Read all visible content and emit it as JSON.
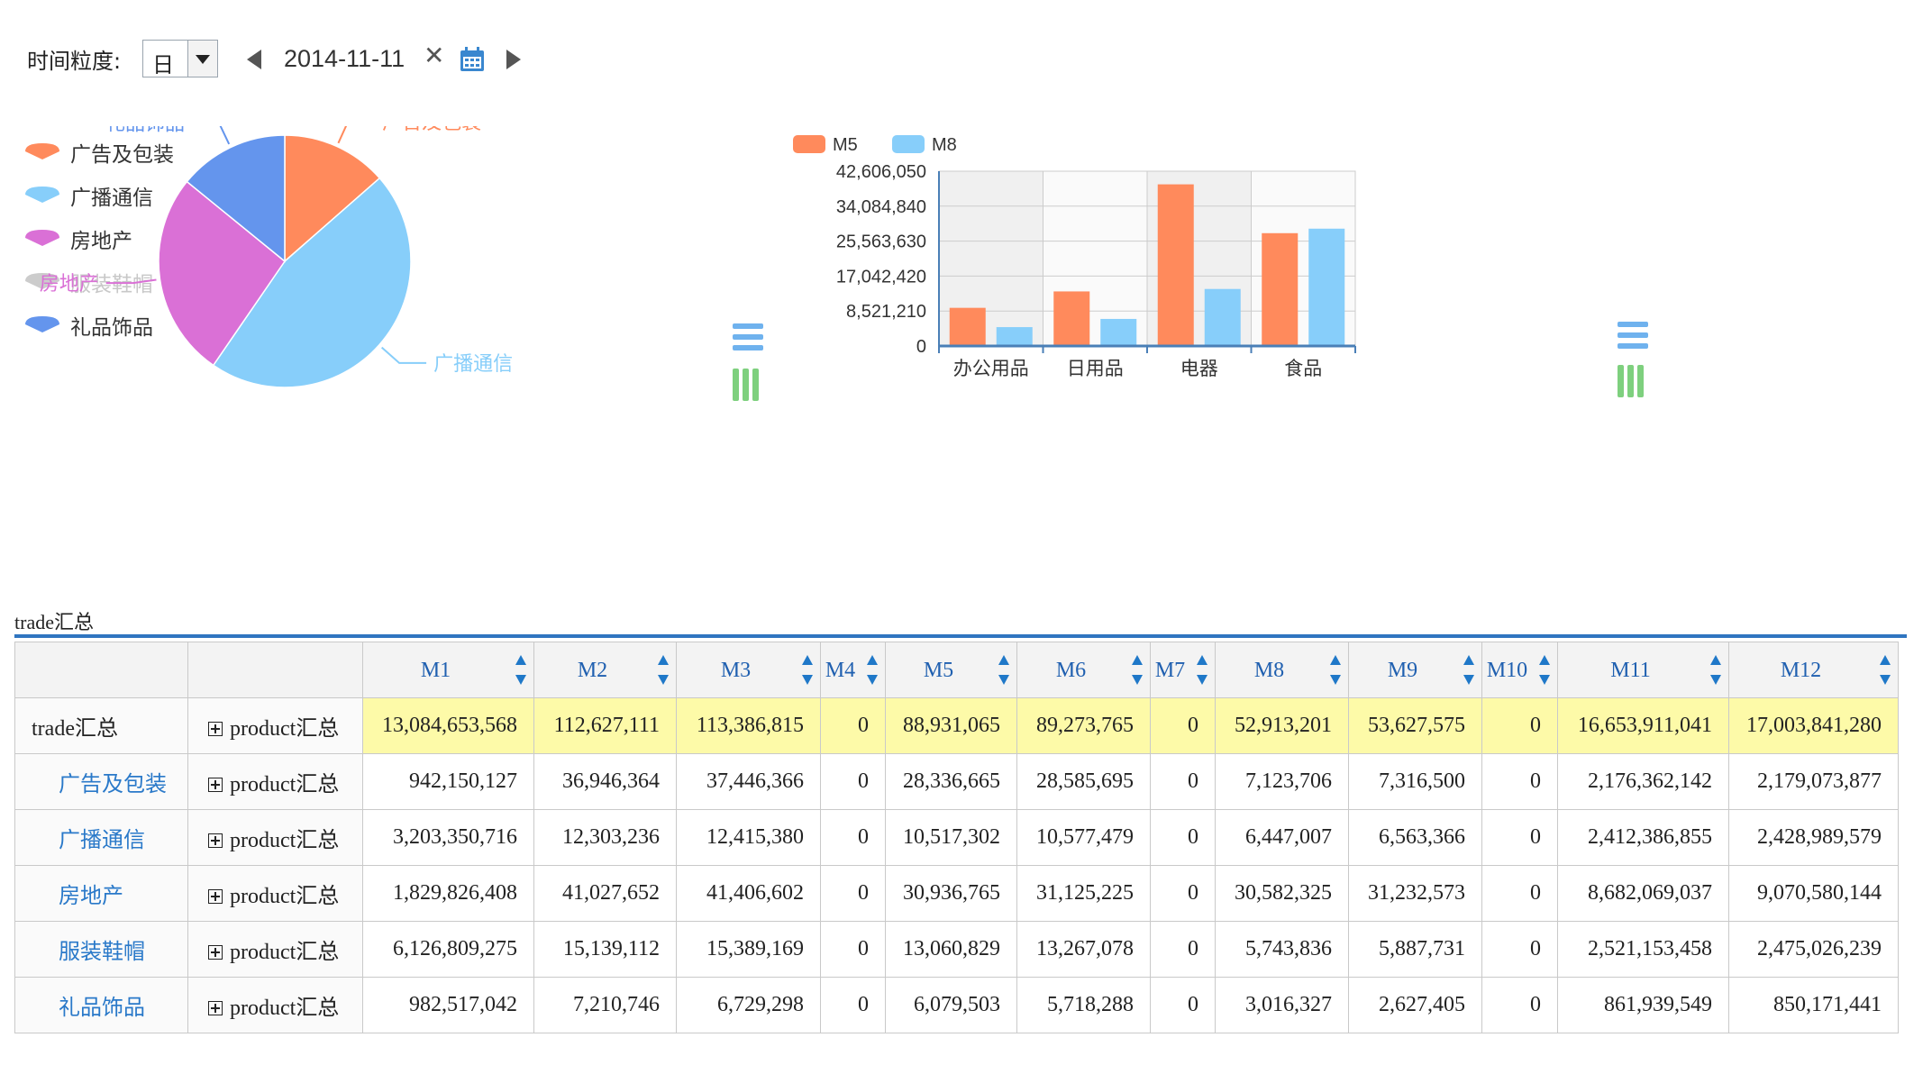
{
  "toolbar": {
    "granularity_label": "时间粒度:",
    "granularity_value": "日",
    "date": "2014-11-11",
    "clear_symbol": "✕",
    "icons": [
      "prev-arrow-icon",
      "clear-icon",
      "calendar-icon",
      "next-arrow-icon"
    ]
  },
  "colors": {
    "orange": "#ff8a5c",
    "lightblue": "#87cefa",
    "orchid": "#da70d6",
    "blue": "#6495ed",
    "grey": "#cccccc",
    "green": "#66cc66",
    "accent": "#2f75c0",
    "total_row": "#fdfaa8"
  },
  "chart_data": [
    {
      "type": "pie",
      "legend_position": "top-left",
      "legend": [
        {
          "name": "广告及包装",
          "color": "#ff8a5c",
          "enabled": true
        },
        {
          "name": "广播通信",
          "color": "#87cefa",
          "enabled": true
        },
        {
          "name": "房地产",
          "color": "#da70d6",
          "enabled": true
        },
        {
          "name": "服装鞋帽",
          "color": "#cccccc",
          "enabled": false
        },
        {
          "name": "礼品饰品",
          "color": "#6495ed",
          "enabled": true
        }
      ],
      "slices": [
        {
          "name": "广告及包装",
          "value": 942150127,
          "color": "#ff8a5c"
        },
        {
          "name": "广播通信",
          "value": 3203350716,
          "color": "#87cefa"
        },
        {
          "name": "房地产",
          "value": 1829826408,
          "color": "#da70d6"
        },
        {
          "name": "礼品饰品",
          "value": 982517042,
          "color": "#6495ed"
        }
      ],
      "slice_labels": [
        "广告及包装",
        "广播通信",
        "房地产",
        "礼品饰品"
      ]
    },
    {
      "type": "bar",
      "legend_position": "top-left",
      "categories": [
        "办公用品",
        "日用品",
        "电器",
        "食品"
      ],
      "series": [
        {
          "name": "M5",
          "color": "#ff8a5c",
          "values": [
            9300000,
            13300000,
            39400000,
            27500000
          ]
        },
        {
          "name": "M8",
          "color": "#87cefa",
          "values": [
            4600000,
            6600000,
            13900000,
            28600000
          ]
        }
      ],
      "yticks": [
        "0",
        "8,521,210",
        "17,042,420",
        "25,563,630",
        "34,084,840",
        "42,606,050"
      ],
      "ylim": [
        0,
        42606050
      ],
      "grid": true
    }
  ],
  "table": {
    "title": "trade汇总",
    "columns": [
      "M1",
      "M2",
      "M3",
      "M4",
      "M5",
      "M6",
      "M7",
      "M8",
      "M9",
      "M10",
      "M11",
      "M12"
    ],
    "dim_label": "product汇总",
    "rows": [
      {
        "label": "trade汇总",
        "total": true,
        "values": [
          "13,084,653,568",
          "112,627,111",
          "113,386,815",
          "0",
          "88,931,065",
          "89,273,765",
          "0",
          "52,913,201",
          "53,627,575",
          "0",
          "16,653,911,041",
          "17,003,841,280"
        ]
      },
      {
        "label": "广告及包装",
        "total": false,
        "values": [
          "942,150,127",
          "36,946,364",
          "37,446,366",
          "0",
          "28,336,665",
          "28,585,695",
          "0",
          "7,123,706",
          "7,316,500",
          "0",
          "2,176,362,142",
          "2,179,073,877"
        ]
      },
      {
        "label": "广播通信",
        "total": false,
        "values": [
          "3,203,350,716",
          "12,303,236",
          "12,415,380",
          "0",
          "10,517,302",
          "10,577,479",
          "0",
          "6,447,007",
          "6,563,366",
          "0",
          "2,412,386,855",
          "2,428,989,579"
        ]
      },
      {
        "label": "房地产",
        "total": false,
        "values": [
          "1,829,826,408",
          "41,027,652",
          "41,406,602",
          "0",
          "30,936,765",
          "31,125,225",
          "0",
          "30,582,325",
          "31,232,573",
          "0",
          "8,682,069,037",
          "9,070,580,144"
        ]
      },
      {
        "label": "服装鞋帽",
        "total": false,
        "values": [
          "6,126,809,275",
          "15,139,112",
          "15,389,169",
          "0",
          "13,060,829",
          "13,267,078",
          "0",
          "5,743,836",
          "5,887,731",
          "0",
          "2,521,153,458",
          "2,475,026,239"
        ]
      },
      {
        "label": "礼品饰品",
        "total": false,
        "values": [
          "982,517,042",
          "7,210,746",
          "6,729,298",
          "0",
          "6,079,503",
          "5,718,288",
          "0",
          "3,016,327",
          "2,627,405",
          "0",
          "861,939,549",
          "850,171,441"
        ]
      }
    ]
  }
}
